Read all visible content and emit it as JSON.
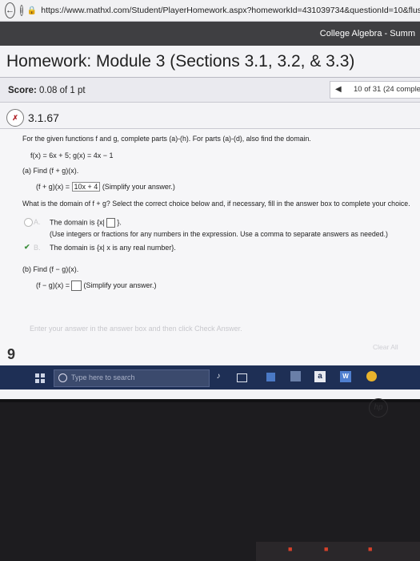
{
  "browser": {
    "url": "https://www.mathxl.com/Student/PlayerHomework.aspx?homeworkId=431039734&questionId=10&flush"
  },
  "header": {
    "course": "College Algebra - Summ"
  },
  "title": "Homework: Module 3 (Sections 3.1, 3.2, & 3.3)",
  "score": {
    "label": "Score:",
    "value": "0.08 of 1 pt"
  },
  "nav": {
    "arrow": "◀",
    "position": "10 of 31 (24 comple"
  },
  "question": {
    "icon_text": "✗",
    "number": "3.1.67",
    "prompt": "For the given functions f and g, complete parts (a)-(h). For parts (a)-(d), also find the domain.",
    "functions": "f(x) = 6x + 5;  g(x) = 4x − 1",
    "part_a": {
      "label": "(a) Find (f + g)(x).",
      "prefix": "(f + g)(x) = ",
      "answer": "10x + 4",
      "hint": "(Simplify your answer.)"
    },
    "domain_question": "What is the domain of f + g? Select the correct choice below and, if necessary, fill in the answer box to complete your choice.",
    "choice_a": {
      "letter": "A.",
      "text": "The domain is {x|",
      "close": "}.",
      "instruction": "(Use integers or fractions for any numbers in the expression. Use a comma to separate answers as needed.)"
    },
    "choice_b": {
      "letter": "B.",
      "text": "The domain is {x| x is any real number}."
    },
    "part_b": {
      "label": "(b) Find (f − g)(x).",
      "prefix": "(f − g)(x) =",
      "hint": "(Simplify your answer.)"
    },
    "footer_hint": "Enter your answer in the answer box and then click Check Answer.",
    "parts_count": "9",
    "clear_all": "Clear All"
  },
  "taskbar": {
    "search_placeholder": "Type here to search",
    "letter_icon": "a",
    "word_icon": "W"
  },
  "hardware": {
    "logo": "hp"
  },
  "colors": {
    "header_bg": "#3f3f42",
    "taskbar_bg": "#1e2f55",
    "incorrect_red": "#b3272d",
    "correct_green": "#3d8f3d"
  }
}
